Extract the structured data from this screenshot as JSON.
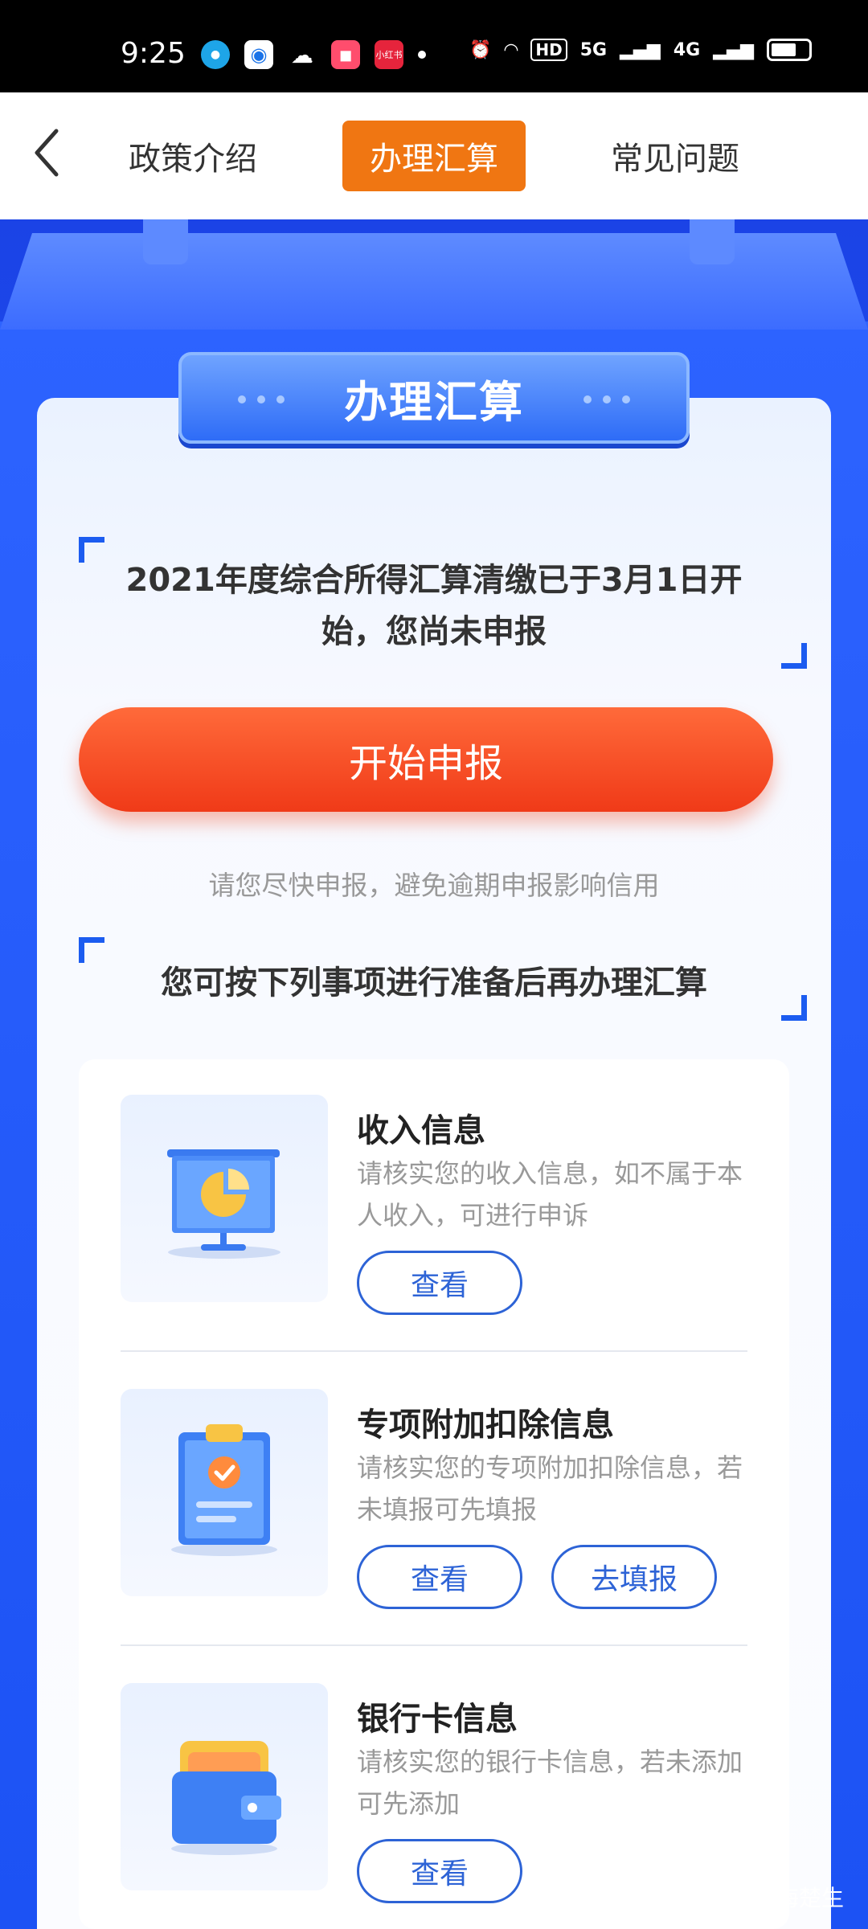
{
  "status_bar": {
    "time": "9:25",
    "hd": "HD",
    "network_1": "5G",
    "network_2": "4G",
    "app_xhs": "小红书"
  },
  "nav": {
    "tabs": [
      {
        "label": "政策介绍"
      },
      {
        "label": "办理汇算"
      },
      {
        "label": "常见问题"
      }
    ]
  },
  "banner": {
    "title": "办理汇算"
  },
  "notice": {
    "text": "2021年度综合所得汇算清缴已于3月1日开始，您尚未申报"
  },
  "start_button": {
    "label": "开始申报"
  },
  "hint": {
    "text": "请您尽快申报，避免逾期申报影响信用"
  },
  "prep_title": {
    "text": "您可按下列事项进行准备后再办理汇算"
  },
  "items": [
    {
      "title": "收入信息",
      "desc": "请核实您的收入信息，如不属于本人收入，可进行申诉",
      "buttons": [
        "查看"
      ]
    },
    {
      "title": "专项附加扣除信息",
      "desc": "请核实您的专项附加扣除信息，若未填报可先填报",
      "buttons": [
        "查看",
        "去填报"
      ]
    },
    {
      "title": "银行卡信息",
      "desc": "请核实您的银行卡信息，若未添加可先添加",
      "buttons": [
        "查看"
      ]
    }
  ],
  "watermark": {
    "text": "头条 @书海楚生"
  },
  "colors": {
    "accent_orange": "#f07612",
    "brand_blue": "#1f4ff0",
    "start_red": "#f03a18",
    "button_blue": "#2d63d6"
  }
}
